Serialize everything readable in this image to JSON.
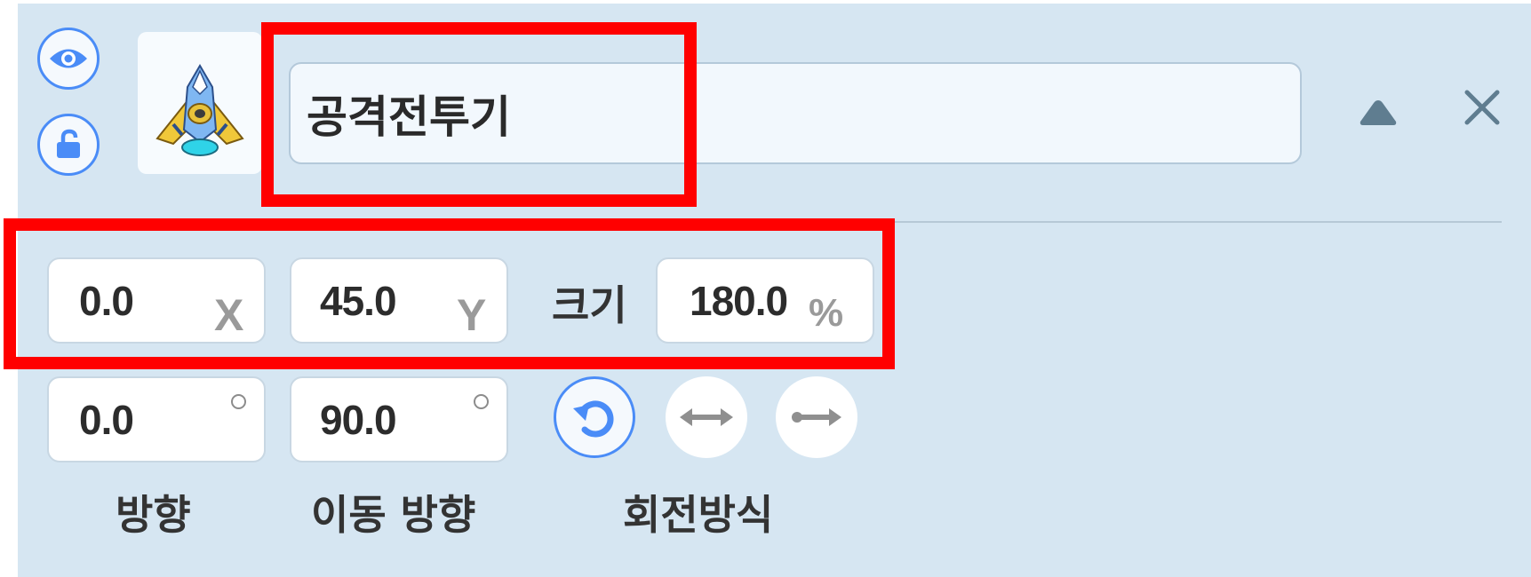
{
  "object": {
    "name": "공격전투기",
    "visible_icon": "eye-icon",
    "lock_icon": "unlock-icon",
    "thumbnail": "spaceship-sprite"
  },
  "header_controls": {
    "collapse_icon": "triangle-up-icon",
    "close_icon": "close-icon"
  },
  "position": {
    "x_value": "0.0",
    "x_unit": "X",
    "y_value": "45.0",
    "y_unit": "Y",
    "size_label": "크기",
    "size_value": "180.0",
    "size_unit": "%"
  },
  "direction": {
    "direction_value": "0.0",
    "move_direction_value": "90.0",
    "direction_label": "방향",
    "move_direction_label": "이동 방향"
  },
  "rotation": {
    "label": "회전방식",
    "options": [
      "rotate-free-icon",
      "flip-horizontal-icon",
      "no-rotate-icon"
    ],
    "selected": "rotate-free-icon"
  },
  "colors": {
    "panel_bg": "#d6e6f2",
    "accent": "#4a8cf7",
    "highlight": "#ff0000"
  }
}
